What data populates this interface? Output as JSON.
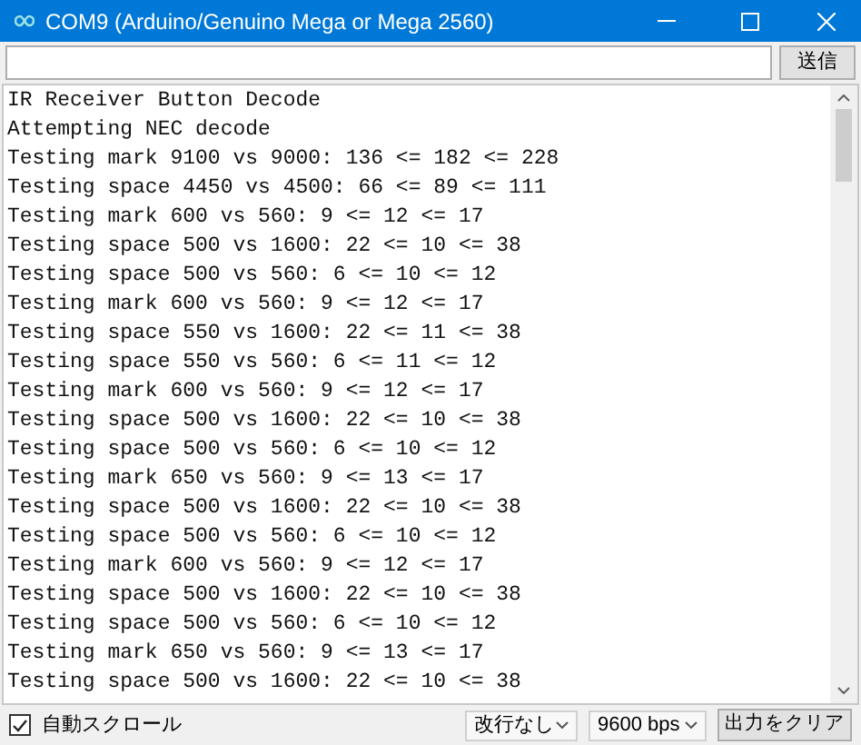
{
  "window": {
    "title": "COM9 (Arduino/Genuino Mega or Mega 2560)"
  },
  "send_button": "送信",
  "output": [
    "IR Receiver Button Decode",
    "Attempting NEC decode",
    "Testing mark 9100 vs 9000: 136 <= 182 <= 228",
    "Testing space 4450 vs 4500: 66 <= 89 <= 111",
    "Testing mark 600 vs 560: 9 <= 12 <= 17",
    "Testing space 500 vs 1600: 22 <= 10 <= 38",
    "Testing space 500 vs 560: 6 <= 10 <= 12",
    "Testing mark 600 vs 560: 9 <= 12 <= 17",
    "Testing space 550 vs 1600: 22 <= 11 <= 38",
    "Testing space 550 vs 560: 6 <= 11 <= 12",
    "Testing mark 600 vs 560: 9 <= 12 <= 17",
    "Testing space 500 vs 1600: 22 <= 10 <= 38",
    "Testing space 500 vs 560: 6 <= 10 <= 12",
    "Testing mark 650 vs 560: 9 <= 13 <= 17",
    "Testing space 500 vs 1600: 22 <= 10 <= 38",
    "Testing space 500 vs 560: 6 <= 10 <= 12",
    "Testing mark 600 vs 560: 9 <= 12 <= 17",
    "Testing space 500 vs 1600: 22 <= 10 <= 38",
    "Testing space 500 vs 560: 6 <= 10 <= 12",
    "Testing mark 650 vs 560: 9 <= 13 <= 17",
    "Testing space 500 vs 1600: 22 <= 10 <= 38"
  ],
  "autoscroll": {
    "label": "自動スクロール",
    "checked": true
  },
  "line_ending": "改行なし",
  "baud_rate": "9600 bps",
  "clear_button": "出力をクリア"
}
